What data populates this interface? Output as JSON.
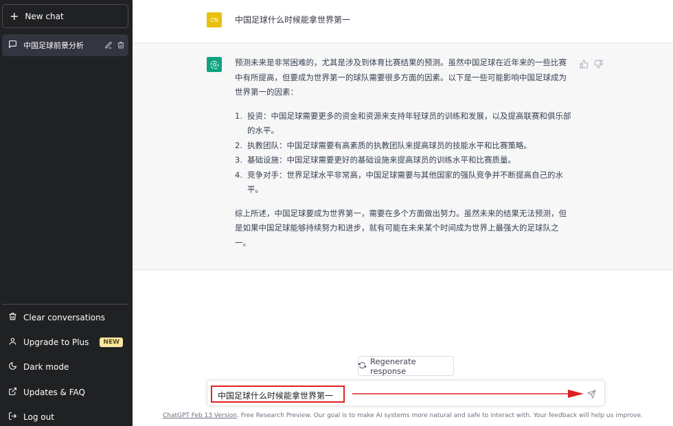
{
  "sidebar": {
    "new_chat": "New chat",
    "chat_item": "中国足球前景分析",
    "menu": {
      "clear": "Clear conversations",
      "upgrade": "Upgrade to Plus",
      "upgrade_badge": "NEW",
      "dark_mode": "Dark mode",
      "updates": "Updates & FAQ",
      "logout": "Log out"
    }
  },
  "conversation": {
    "user_avatar": "CN",
    "user_message": "中国足球什么时候能拿世界第一",
    "bot_intro": "预测未来是非常困难的，尤其是涉及到体育比赛结果的预测。虽然中国足球在近年来的一些比赛中有所提高，但要成为世界第一的球队需要很多方面的因素。以下是一些可能影响中国足球成为世界第一的因素：",
    "bot_list": [
      {
        "num": "1.",
        "text": "投资：中国足球需要更多的资金和资源来支持年轻球员的训练和发展，以及提高联赛和俱乐部的水平。"
      },
      {
        "num": "2.",
        "text": "执教团队：中国足球需要有高素质的执教团队来提高球员的技能水平和比赛策略。"
      },
      {
        "num": "3.",
        "text": "基础设施：中国足球需要更好的基础设施来提高球员的训练水平和比赛质量。"
      },
      {
        "num": "4.",
        "text": "竞争对手：世界足球水平非常高，中国足球需要与其他国家的强队竞争并不断提高自己的水平。"
      }
    ],
    "bot_conclusion": "综上所述，中国足球要成为世界第一，需要在多个方面做出努力。虽然未来的结果无法预测，但是如果中国足球能够持续努力和进步，就有可能在未来某个时间成为世界上最强大的足球队之一。"
  },
  "regenerate": "Regenerate response",
  "input": {
    "value": "中国足球什么时候能拿世界第一"
  },
  "footer": {
    "link": "ChatGPT Feb 13 Version",
    "text": ". Free Research Preview. Our goal is to make AI systems more natural and safe to interact with. Your feedback will help us improve."
  },
  "colors": {
    "sidebar_bg": "#202123",
    "active_item_bg": "#343541",
    "bot_row_bg": "#f7f7f8",
    "bot_avatar": "#10a37f",
    "user_avatar": "#e8c10f",
    "highlight": "#e02020"
  },
  "icons": [
    "plus-icon",
    "chat-bubble-icon",
    "edit-icon",
    "trash-icon",
    "user-icon",
    "moon-icon",
    "external-link-icon",
    "logout-icon",
    "openai-logo-icon",
    "thumbs-up-icon",
    "thumbs-down-icon",
    "refresh-icon",
    "send-icon",
    "red-arrow-icon"
  ]
}
